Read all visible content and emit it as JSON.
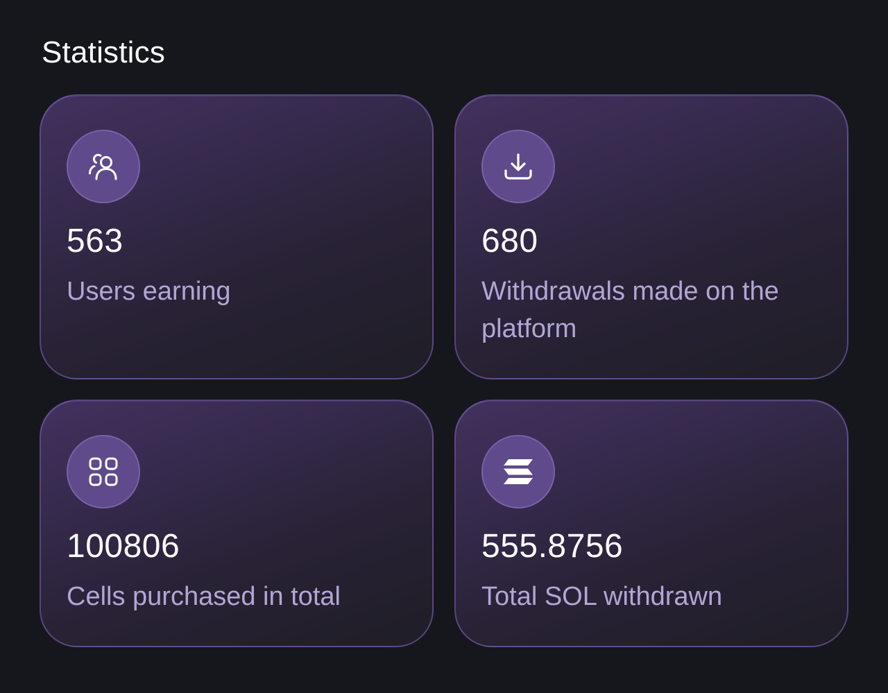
{
  "section": {
    "title": "Statistics"
  },
  "colors": {
    "background": "#16171c",
    "card_gradient_start": "#42315e",
    "card_gradient_end": "#1f1d26",
    "icon_circle": "#5f4a8b",
    "value_text": "#ffffff",
    "label_text": "#b3a6d6"
  },
  "stats": [
    {
      "icon": "users-icon",
      "value": "563",
      "label": "Users earning"
    },
    {
      "icon": "download-icon",
      "value": "680",
      "label": "Withdrawals made on the platform"
    },
    {
      "icon": "grid-icon",
      "value": "100806",
      "label": "Cells purchased in total"
    },
    {
      "icon": "solana-icon",
      "value": "555.8756",
      "label": "Total SOL withdrawn"
    }
  ]
}
